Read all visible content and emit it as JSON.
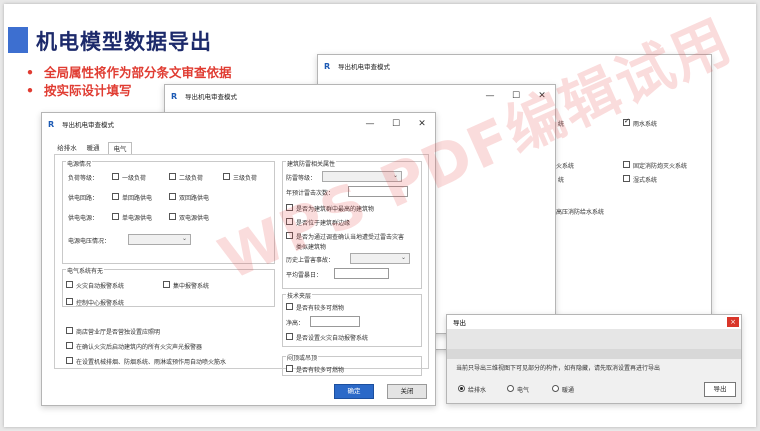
{
  "slide": {
    "title": "机电模型数据导出",
    "bullets": [
      "全局属性将作为部分条文审查依据",
      "按实际设计填写"
    ]
  },
  "watermark": "WPS PDF编辑试用",
  "dialog_title": "导出机电审查模式",
  "window_buttons": {
    "minimize": "—",
    "maximize": "☐",
    "close": "✕"
  },
  "back_window": {
    "items": [
      "统",
      "雨水系统",
      "火系统",
      "固定消防炮灭火系统",
      "统",
      "湿式系统",
      "高压消防给水系统"
    ]
  },
  "main_dialog": {
    "tabs": [
      "给排水",
      "暖通",
      "电气"
    ],
    "active_tab": "电气",
    "power": {
      "legend": "电源情况",
      "load_level_label": "负荷等级：",
      "load_levels": [
        "一级负荷",
        "二级负荷",
        "三级负荷"
      ],
      "circuit_label": "供电回路：",
      "circuits": [
        "单回路供电",
        "双回路供电"
      ],
      "source_label": "供电电源：",
      "sources": [
        "单电源供电",
        "双电源供电"
      ],
      "voltage_label": "电源电压情况："
    },
    "systems": {
      "legend": "电气系统有无",
      "items": [
        "火灾自动报警系统",
        "集中报警系统",
        "控制中心报警系统"
      ]
    },
    "extra_options": [
      "商店营业厅是否营独设置应照明",
      "在确认火灾后启动建筑内的所有火灾声光报警器",
      "在设置机械排烟、防烟系统、雨淋或预作用自动喷火筋水"
    ],
    "lightning": {
      "legend": "建筑防雷相关属性",
      "level_label": "防雷等级：",
      "strikes_label": "年预计雷击次数：",
      "checks": [
        "是否为建筑群中最高的建筑物",
        "是否位于建筑群边缘",
        "是否为通过调查确认当地遭受过雷击灾害",
        "类似建筑物"
      ],
      "history_label": "历史上雷害事故：",
      "thunder_days_label": "平均雷暴日："
    },
    "interlayer": {
      "legend": "技术夹层",
      "check1": "是否有较多可燃物",
      "height_label": "净高：",
      "check2": "是否设置火灾自动报警系统"
    },
    "corridor": {
      "legend": "闷顶或吊顶",
      "check": "是否有较多可燃物"
    },
    "ok_label": "确定",
    "close_label": "关闭"
  },
  "export_dialog": {
    "title": "导出",
    "close": "×",
    "message": "当前只导出三维视图下可见部分的构件，如有隐藏，请先取消设置再进行导出",
    "options": [
      "给排水",
      "电气",
      "暖通"
    ],
    "selected": "给排水",
    "button": "导出"
  }
}
